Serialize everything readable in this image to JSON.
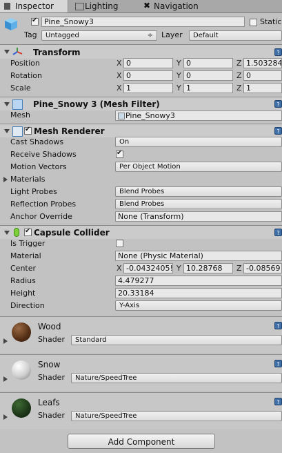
{
  "tabs": [
    {
      "label": "Inspector",
      "icon": "inspector-icon"
    },
    {
      "label": "Lighting",
      "icon": "lighting-icon"
    },
    {
      "label": "Navigation",
      "icon": "navigation-icon"
    }
  ],
  "object": {
    "name": "Pine_Snowy3",
    "static_label": "Static",
    "tag_label": "Tag",
    "tag_value": "Untagged",
    "layer_label": "Layer",
    "layer_value": "Default"
  },
  "transform": {
    "title": "Transform",
    "position_label": "Position",
    "position": {
      "x": "0",
      "y": "0",
      "z": "1.503284"
    },
    "rotation_label": "Rotation",
    "rotation": {
      "x": "0",
      "y": "0",
      "z": "0"
    },
    "scale_label": "Scale",
    "scale": {
      "x": "1",
      "y": "1",
      "z": "1"
    }
  },
  "mesh_filter": {
    "title": "Pine_Snowy 3 (Mesh Filter)",
    "mesh_label": "Mesh",
    "mesh_value": "Pine_Snowy3"
  },
  "mesh_renderer": {
    "title": "Mesh Renderer",
    "cast_shadows_label": "Cast Shadows",
    "cast_shadows": "On",
    "receive_shadows_label": "Receive Shadows",
    "motion_vectors_label": "Motion Vectors",
    "motion_vectors": "Per Object Motion",
    "materials_label": "Materials",
    "light_probes_label": "Light Probes",
    "light_probes": "Blend Probes",
    "reflection_probes_label": "Reflection Probes",
    "reflection_probes": "Blend Probes",
    "anchor_override_label": "Anchor Override",
    "anchor_override": "None (Transform)"
  },
  "capsule_collider": {
    "title": "Capsule Collider",
    "is_trigger_label": "Is Trigger",
    "material_label": "Material",
    "material": "None (Physic Material)",
    "center_label": "Center",
    "center": {
      "x": "-0.0432405!",
      "y": "10.28768",
      "z": "-0.08569"
    },
    "radius_label": "Radius",
    "radius": "4.479277",
    "height_label": "Height",
    "height": "20.33184",
    "direction_label": "Direction",
    "direction": "Y-Axis"
  },
  "axis_labels": {
    "x": "X",
    "y": "Y",
    "z": "Z"
  },
  "materials": [
    {
      "name": "Wood",
      "shader_label": "Shader",
      "shader": "Standard",
      "color": "#5a3318"
    },
    {
      "name": "Snow",
      "shader_label": "Shader",
      "shader": "Nature/SpeedTree",
      "color": "#cfcfcf"
    },
    {
      "name": "Leafs",
      "shader_label": "Shader",
      "shader": "Nature/SpeedTree",
      "color": "#1f3a1a"
    }
  ],
  "add_component_label": "Add Component",
  "help_glyph": "?"
}
